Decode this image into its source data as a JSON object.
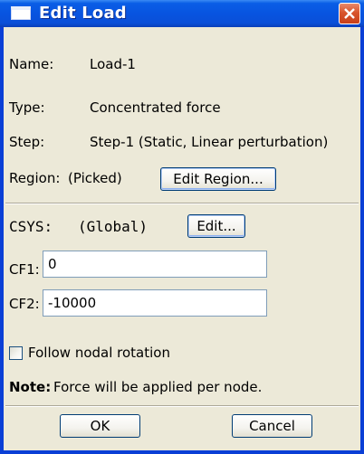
{
  "window": {
    "title": "Edit Load"
  },
  "info": {
    "name_label": "Name:",
    "name_value": "Load-1",
    "type_label": "Type:",
    "type_value": "Concentrated force",
    "step_label": "Step:",
    "step_value": "Step-1 (Static, Linear perturbation)",
    "region_label": "Region:",
    "region_value": "(Picked)",
    "edit_region_label": "Edit Region..."
  },
  "csys": {
    "label": "CSYS:",
    "value": "(Global)",
    "edit_label": "Edit..."
  },
  "fields": {
    "cf1_label": "CF1:",
    "cf1_value": "0",
    "cf2_label": "CF2:",
    "cf2_value": "-10000"
  },
  "options": {
    "follow_nodal_rotation_label": "Follow nodal rotation",
    "follow_nodal_rotation_checked": false
  },
  "note": {
    "bold": "Note:",
    "text": "Force will be applied per node."
  },
  "footer": {
    "ok_label": "OK",
    "cancel_label": "Cancel"
  }
}
